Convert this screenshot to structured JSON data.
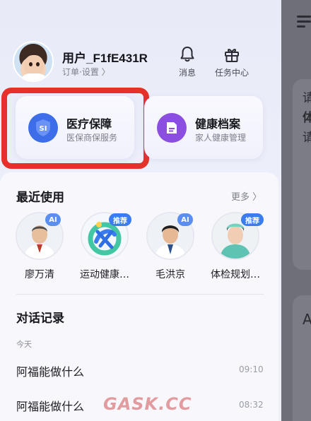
{
  "user": {
    "name": "用户_F1fE431R",
    "links": "订单·设置 〉"
  },
  "top_actions": [
    {
      "label": "消息",
      "icon": "bell-icon"
    },
    {
      "label": "任务中心",
      "icon": "gift-icon"
    }
  ],
  "services": [
    {
      "title": "医疗保障",
      "subtitle": "医保商保服务",
      "icon_text": "SI",
      "icon": "shield-icon",
      "color": "#3d6de8"
    },
    {
      "title": "健康档案",
      "subtitle": "家人健康管理",
      "icon": "document-icon",
      "color": "#8a4fe0"
    }
  ],
  "recent": {
    "title": "最近使用",
    "more": "更多 〉",
    "items": [
      {
        "label": "廖万清",
        "badge": "AI",
        "badge_color": "#5a8ef0"
      },
      {
        "label": "运动健康…",
        "badge": "推荐",
        "badge_color": "#3b7cf0"
      },
      {
        "label": "毛洪京",
        "badge": "AI",
        "badge_color": "#5a8ef0"
      },
      {
        "label": "体检规划…",
        "badge": "推荐",
        "badge_color": "#3b7cf0"
      }
    ]
  },
  "conversations": {
    "title": "对话记录",
    "day": "今天",
    "items": [
      {
        "title": "阿福能做什么",
        "time": "09:10"
      },
      {
        "title": "阿福能做什么",
        "time": "08:32"
      }
    ]
  },
  "peek": {
    "lines": [
      "请",
      "体",
      "请",
      "A"
    ]
  },
  "watermark": "GASK.CC"
}
